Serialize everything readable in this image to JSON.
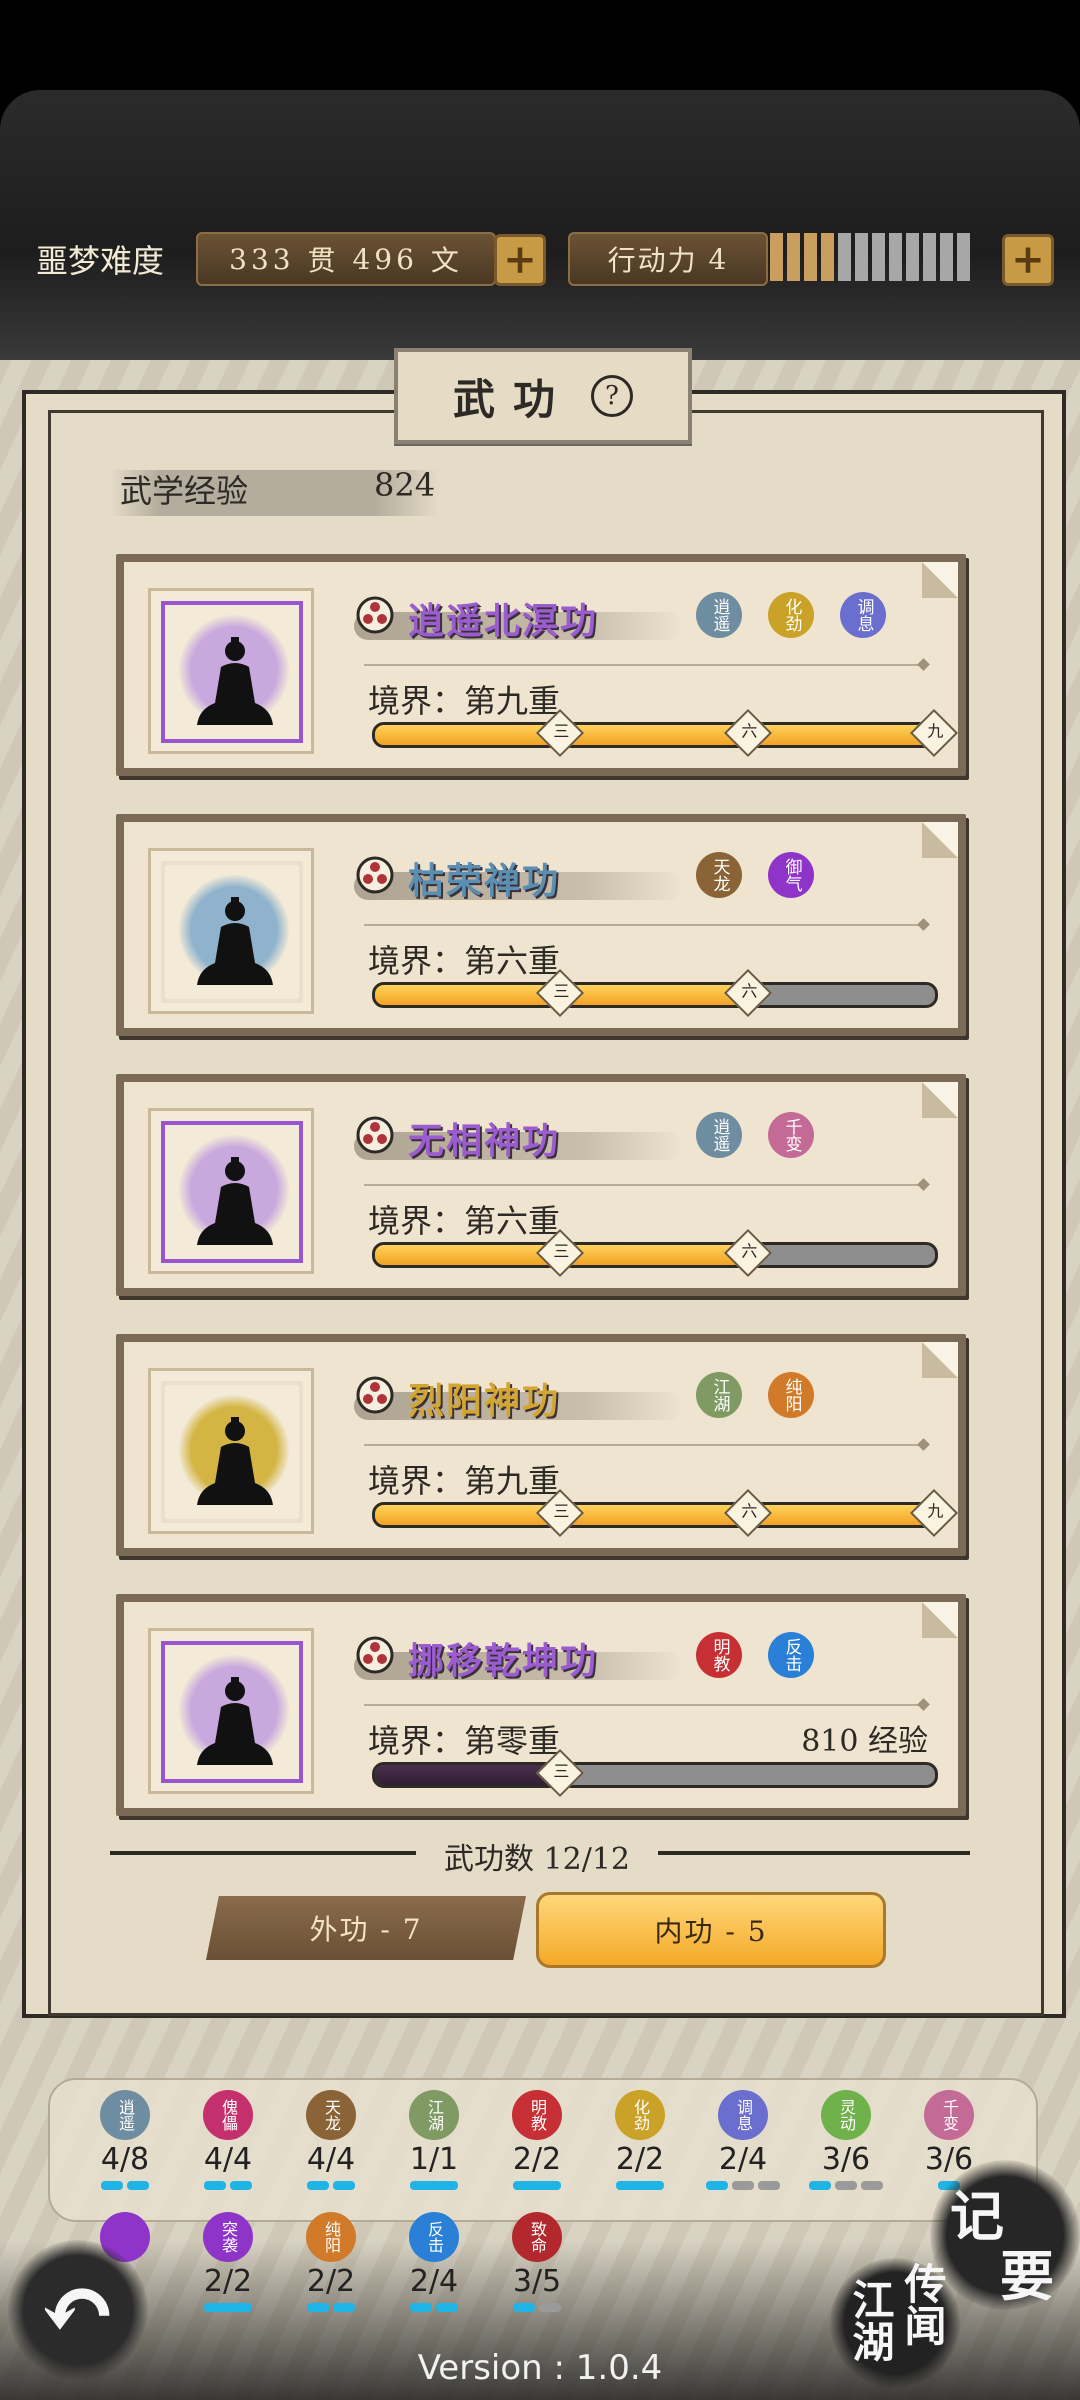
{
  "topbar": {
    "difficulty_label": "噩梦难度",
    "money_guan": "333",
    "money_guan_unit": "贯",
    "money_wen": "496",
    "money_wen_unit": "文",
    "stamina_label": "行动力",
    "stamina_value": "4",
    "stamina_filled": 4,
    "stamina_total": 12
  },
  "panel": {
    "title": "武功",
    "help_symbol": "?",
    "exp_label": "武学经验",
    "exp_value": "824"
  },
  "skills": [
    {
      "name": "逍遥北溟功",
      "name_color": "#9b5cd0",
      "frame_color": "#9a55d1",
      "halo": "#c9a8de",
      "realm": "境界：第九重",
      "progress": 1.0,
      "tags": [
        {
          "t": "逍遥",
          "c": "#6f8da0"
        },
        {
          "t": "化劲",
          "c": "#c9a227"
        },
        {
          "t": "调息",
          "c": "#6a6ecf"
        }
      ],
      "markers": [
        "三",
        "六",
        "九"
      ]
    },
    {
      "name": "枯荣禅功",
      "name_color": "#5a8fb2",
      "frame_color": "#e8e0cc",
      "halo": "#8fb3cc",
      "realm": "境界：第六重",
      "progress": 0.667,
      "tags": [
        {
          "t": "天龙",
          "c": "#8a6336"
        },
        {
          "t": "御气",
          "c": "#8f34c9"
        }
      ],
      "markers": [
        "三",
        "六"
      ]
    },
    {
      "name": "无相神功",
      "name_color": "#9b5cd0",
      "frame_color": "#9a55d1",
      "halo": "#c9a8de",
      "realm": "境界：第六重",
      "progress": 0.667,
      "tags": [
        {
          "t": "逍遥",
          "c": "#6f8da0"
        },
        {
          "t": "千变",
          "c": "#c46a96"
        }
      ],
      "markers": [
        "三",
        "六"
      ]
    },
    {
      "name": "烈阳神功",
      "name_color": "#d2a630",
      "frame_color": "#e8e0cc",
      "halo": "#d4b544",
      "realm": "境界：第九重",
      "progress": 1.0,
      "tags": [
        {
          "t": "江湖",
          "c": "#7f9a62"
        },
        {
          "t": "纯阳",
          "c": "#d07a2a"
        }
      ],
      "markers": [
        "三",
        "六",
        "九"
      ]
    },
    {
      "name": "挪移乾坤功",
      "name_color": "#9b5cd0",
      "frame_color": "#9a55d1",
      "halo": "#c9a8de",
      "realm": "境界：第零重",
      "exp_text": "810 经验",
      "progress": 0.333,
      "dark": true,
      "tags": [
        {
          "t": "明教",
          "c": "#c63035"
        },
        {
          "t": "反击",
          "c": "#2a7fd6"
        }
      ],
      "markers": [
        "三"
      ]
    }
  ],
  "skill_count": "武功数 12/12",
  "tabs": {
    "outer": "外功 - 7",
    "inner": "内功 - 5"
  },
  "collection": [
    {
      "t": "逍遥",
      "c": "#6f8da0",
      "count": "4/8",
      "on": 2,
      "total": 2
    },
    {
      "t": "傀儡",
      "c": "#c4306e",
      "count": "4/4",
      "on": 2,
      "total": 2
    },
    {
      "t": "天龙",
      "c": "#8a6336",
      "count": "4/4",
      "on": 2,
      "total": 2
    },
    {
      "t": "江湖",
      "c": "#7f9a62",
      "count": "1/1",
      "on": 1,
      "total": 1,
      "wide": true
    },
    {
      "t": "明教",
      "c": "#c63035",
      "count": "2/2",
      "on": 1,
      "total": 1,
      "wide": true
    },
    {
      "t": "化劲",
      "c": "#c9a227",
      "count": "2/2",
      "on": 1,
      "total": 1,
      "wide": true
    },
    {
      "t": "调息",
      "c": "#6a6ecf",
      "count": "2/4",
      "on": 1,
      "total": 3
    },
    {
      "t": "灵动",
      "c": "#6fb24c",
      "count": "3/6",
      "on": 1,
      "total": 3
    },
    {
      "t": "千变",
      "c": "#c46a96",
      "count": "3/6",
      "on": 1,
      "total": 1
    },
    {
      "t": "",
      "c": "#8f34c9",
      "count": "",
      "on": 0,
      "total": 0
    },
    {
      "t": "突袭",
      "c": "#8f34c9",
      "count": "2/2",
      "on": 1,
      "total": 1,
      "wide": true
    },
    {
      "t": "纯阳",
      "c": "#d07a2a",
      "count": "2/2",
      "on": 2,
      "total": 2
    },
    {
      "t": "反击",
      "c": "#2a7fd6",
      "count": "2/4",
      "on": 2,
      "total": 2
    },
    {
      "t": "致命",
      "c": "#b3282d",
      "count": "3/5",
      "on": 1,
      "total": 2
    }
  ],
  "bottom": {
    "back_symbol": "↶",
    "notes_line1": "记",
    "notes_line2": "要",
    "lore_a": "江湖",
    "lore_b": "传闻",
    "version": "Version : 1.0.4"
  }
}
